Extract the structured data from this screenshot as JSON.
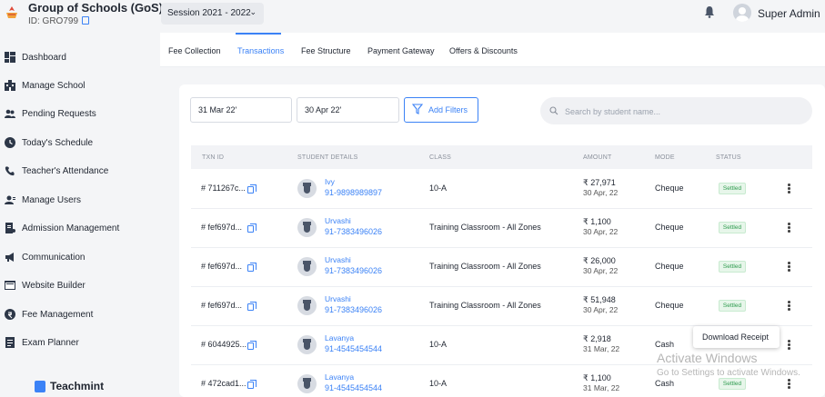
{
  "header": {
    "school_name": "Group of Schools (GoS)",
    "school_id": "ID: GRO799",
    "session": "Session 2021 - 2022",
    "user_name": "Super Admin"
  },
  "sidebar": {
    "items": [
      {
        "label": "Dashboard",
        "icon": "dashboard-icon"
      },
      {
        "label": "Manage School",
        "icon": "school-icon"
      },
      {
        "label": "Pending Requests",
        "icon": "users-icon"
      },
      {
        "label": "Today's Schedule",
        "icon": "clock-icon"
      },
      {
        "label": "Teacher's Attendance",
        "icon": "attendance-icon"
      },
      {
        "label": "Manage Users",
        "icon": "manage-users-icon"
      },
      {
        "label": "Admission Management",
        "icon": "admission-icon"
      },
      {
        "label": "Communication",
        "icon": "megaphone-icon"
      },
      {
        "label": "Website Builder",
        "icon": "website-icon"
      },
      {
        "label": "Fee Management",
        "icon": "fee-icon"
      },
      {
        "label": "Exam Planner",
        "icon": "exam-icon"
      }
    ],
    "brand": "Teachmint"
  },
  "tabs": [
    {
      "label": "Fee Collection",
      "active": false
    },
    {
      "label": "Transactions",
      "active": true
    },
    {
      "label": "Fee Structure",
      "active": false
    },
    {
      "label": "Payment Gateway",
      "active": false
    },
    {
      "label": "Offers & Discounts",
      "active": false
    }
  ],
  "filters": {
    "from_date": "31 Mar 22'",
    "to_date": "30 Apr 22'",
    "add_filters_label": "Add Filters",
    "search_placeholder": "Search by student name..."
  },
  "table": {
    "columns": [
      "TXN ID",
      "STUDENT DETAILS",
      "CLASS",
      "AMOUNT",
      "MODE",
      "STATUS"
    ],
    "rows": [
      {
        "txn_id": "# 711267c...",
        "student_name": "Ivy",
        "phone": "91-9898989897",
        "class": "10-A",
        "amount": "₹ 27,971",
        "date": "30 Apr, 22",
        "mode": "Cheque",
        "status": "Settled"
      },
      {
        "txn_id": "# fef697d...",
        "student_name": "Urvashi",
        "phone": "91-7383496026",
        "class": "Training Classroom - All Zones",
        "amount": "₹ 1,100",
        "date": "30 Apr, 22",
        "mode": "Cheque",
        "status": "Settled"
      },
      {
        "txn_id": "# fef697d...",
        "student_name": "Urvashi",
        "phone": "91-7383496026",
        "class": "Training Classroom - All Zones",
        "amount": "₹ 26,000",
        "date": "30 Apr, 22",
        "mode": "Cheque",
        "status": "Settled"
      },
      {
        "txn_id": "# fef697d...",
        "student_name": "Urvashi",
        "phone": "91-7383496026",
        "class": "Training Classroom - All Zones",
        "amount": "₹ 51,948",
        "date": "30 Apr, 22",
        "mode": "Cheque",
        "status": "Settled"
      },
      {
        "txn_id": "# 6044925...",
        "student_name": "Lavanya",
        "phone": "91-4545454544",
        "class": "10-A",
        "amount": "₹ 2,918",
        "date": "31 Mar, 22",
        "mode": "Cash",
        "status": ""
      },
      {
        "txn_id": "# 472cad1...",
        "student_name": "Lavanya",
        "phone": "91-4545454544",
        "class": "10-A",
        "amount": "₹ 1,100",
        "date": "31 Mar, 22",
        "mode": "Cash",
        "status": "Settled"
      }
    ]
  },
  "popup": {
    "download_receipt": "Download Receipt"
  },
  "watermark": {
    "line1": "Activate Windows",
    "line2": "Go to Settings to activate Windows."
  },
  "colors": {
    "accent": "#3b82f6",
    "settled_bg": "#e7f6ea",
    "settled_text": "#2e9b4e"
  }
}
